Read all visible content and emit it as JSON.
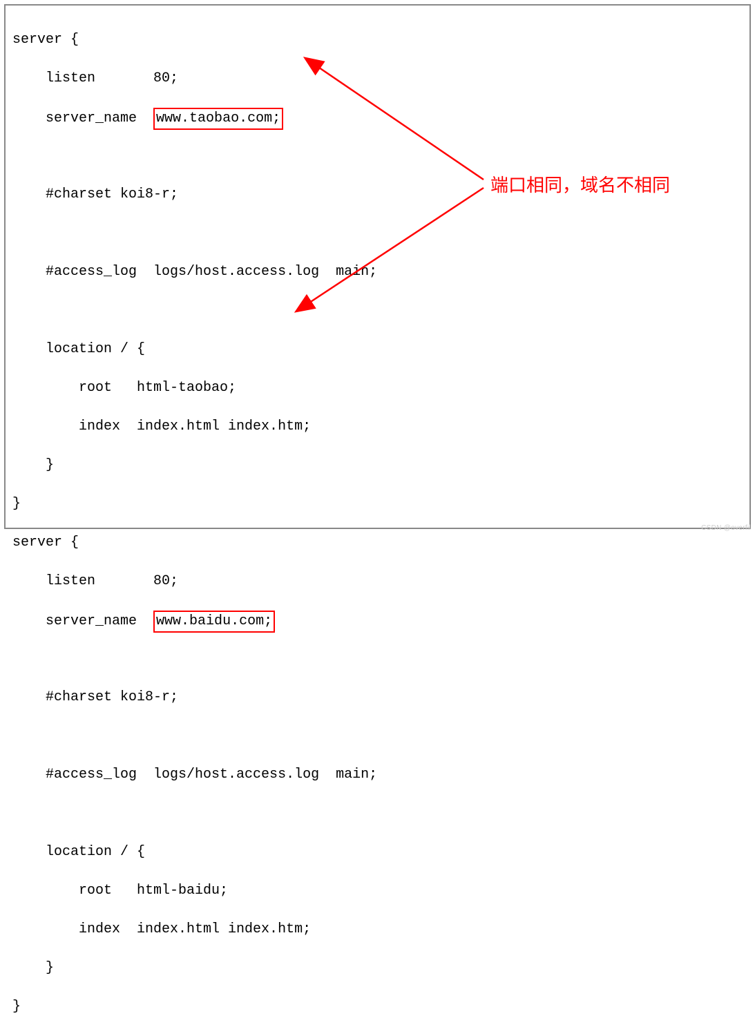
{
  "code": {
    "l1": "server {",
    "l2a": "    listen       80;",
    "l3a": "    server_name  ",
    "hl1": "www.taobao.com;",
    "l4": "",
    "l5": "    #charset koi8-r;",
    "l6": "",
    "l7": "    #access_log  logs/host.access.log  main;",
    "l8": "",
    "l9": "    location / {",
    "l10": "        root   html-taobao;",
    "l11": "        index  index.html index.htm;",
    "l12": "    }",
    "l13": "}",
    "l14": "server {",
    "l15": "    listen       80;",
    "l16a": "    server_name  ",
    "hl2": "www.baidu.com;",
    "l17": "",
    "l18": "    #charset koi8-r;",
    "l19": "",
    "l20": "    #access_log  logs/host.access.log  main;",
    "l21": "",
    "l22": "    location / {",
    "l23": "        root   html-baidu;",
    "l24": "        index  index.html index.htm;",
    "l25": "    }",
    "l26": "}"
  },
  "annotation": "端口相同，域名不相同",
  "watermark": "CSDN @overfil",
  "colors": {
    "border": "#888888",
    "highlight": "#ff0000"
  }
}
